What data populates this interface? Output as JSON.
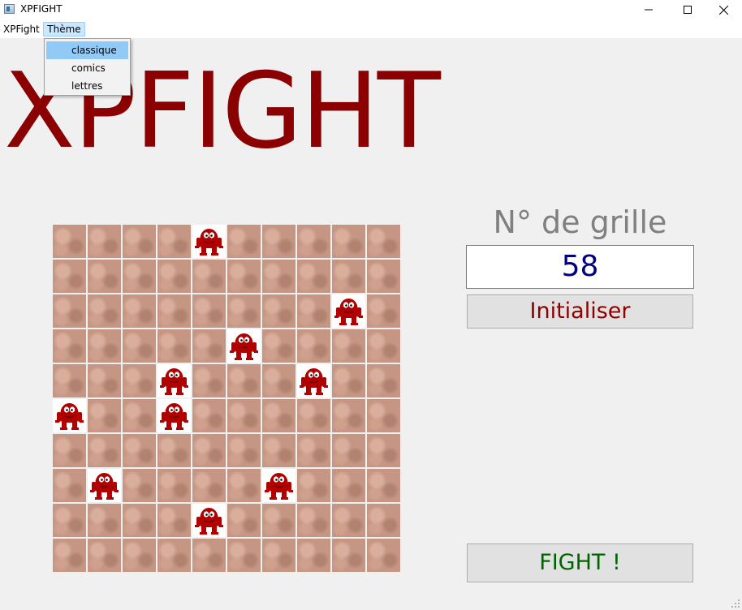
{
  "window": {
    "title": "XPFIGHT",
    "controls": {
      "minimize": "—",
      "maximize": "☐",
      "close": "✕"
    }
  },
  "menubar": {
    "items": [
      "XPFight",
      "Thème"
    ],
    "open_menu": "Thème",
    "dropdown": {
      "items": [
        "classique",
        "comics",
        "lettres"
      ],
      "selected": "classique"
    }
  },
  "header": {
    "title": "XPFIGHT"
  },
  "colors": {
    "title": "#8b0000",
    "monster": "#b00000",
    "number": "#000080",
    "init_label": "#8b0000",
    "fight_label": "#006400",
    "grid_label": "#808080"
  },
  "grid": {
    "rows": 10,
    "cols": 10,
    "monsters": [
      [
        0,
        4
      ],
      [
        2,
        8
      ],
      [
        3,
        5
      ],
      [
        4,
        3
      ],
      [
        4,
        7
      ],
      [
        5,
        0
      ],
      [
        5,
        3
      ],
      [
        7,
        1
      ],
      [
        7,
        6
      ],
      [
        8,
        4
      ]
    ]
  },
  "panel": {
    "grid_label": "N° de grille",
    "grid_number": "58",
    "init_button": "Initialiser",
    "fight_button": "FIGHT !"
  }
}
